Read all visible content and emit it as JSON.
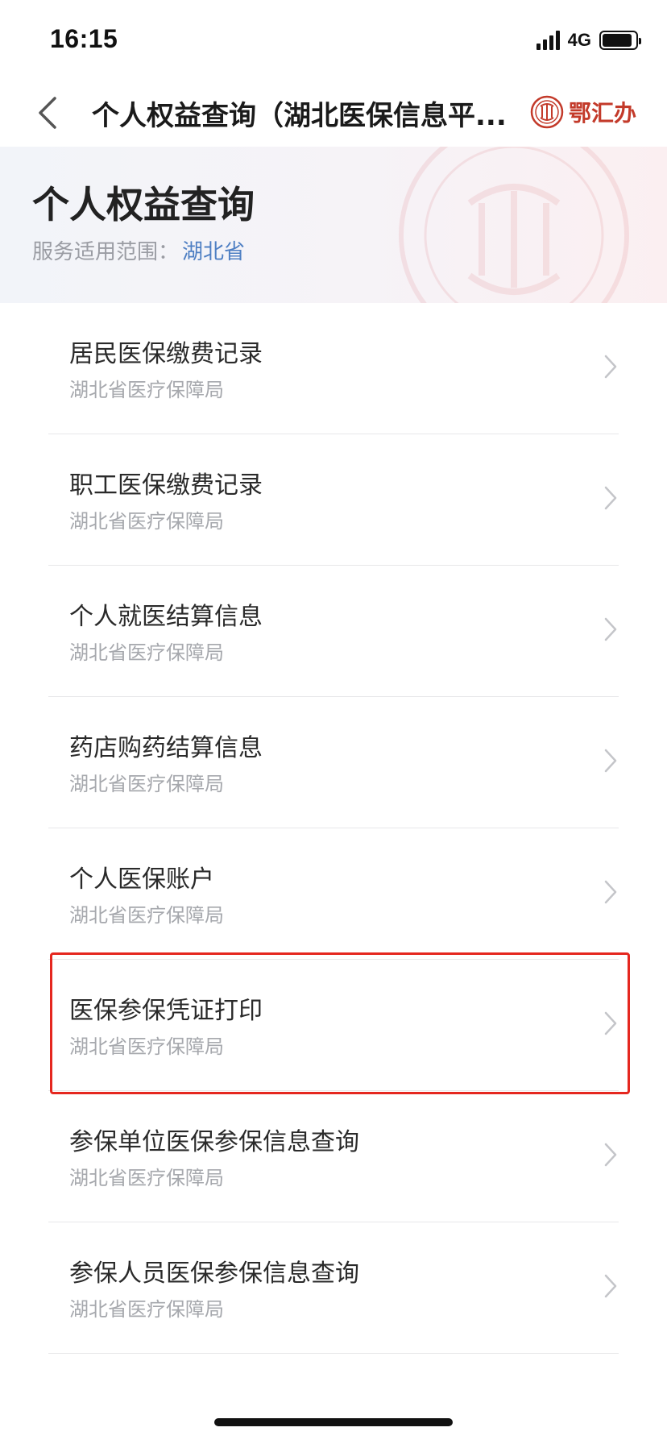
{
  "status_bar": {
    "time": "16:15",
    "network": "4G",
    "battery_level": 0.9
  },
  "nav": {
    "title": "个人权益查询（湖北医保信息平...",
    "brand_name": "鄂汇办",
    "back_icon": "chevron-left-icon",
    "brand_color": "#c33a2a"
  },
  "hero": {
    "title": "个人权益查询",
    "scope_label": "服务适用范围：",
    "scope_value": "湖北省"
  },
  "items": [
    {
      "title": "居民医保缴费记录",
      "subtitle": "湖北省医疗保障局"
    },
    {
      "title": "职工医保缴费记录",
      "subtitle": "湖北省医疗保障局"
    },
    {
      "title": "个人就医结算信息",
      "subtitle": "湖北省医疗保障局"
    },
    {
      "title": "药店购药结算信息",
      "subtitle": "湖北省医疗保障局"
    },
    {
      "title": "个人医保账户",
      "subtitle": "湖北省医疗保障局"
    },
    {
      "title": "医保参保凭证打印",
      "subtitle": "湖北省医疗保障局"
    },
    {
      "title": "参保单位医保参保信息查询",
      "subtitle": "湖北省医疗保障局"
    },
    {
      "title": "参保人员医保参保信息查询",
      "subtitle": "湖北省医疗保障局"
    }
  ],
  "highlight": {
    "item_index": 5,
    "color": "#e5271f"
  }
}
